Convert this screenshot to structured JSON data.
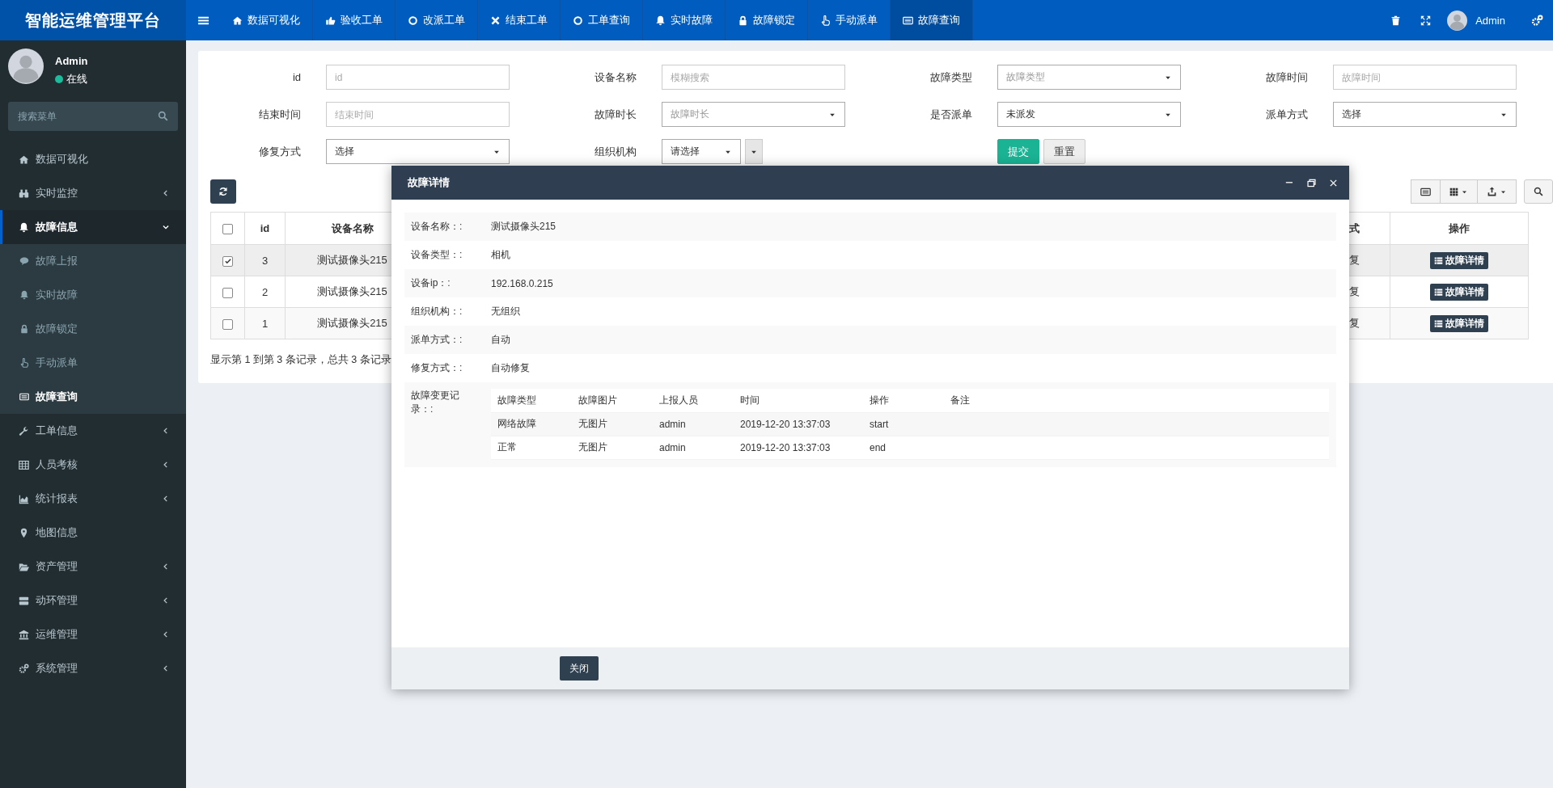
{
  "app": {
    "title": "智能运维管理平台"
  },
  "topnav": {
    "items": [
      {
        "label": "数据可视化",
        "selected": false
      },
      {
        "label": "验收工单",
        "selected": false
      },
      {
        "label": "改派工单",
        "selected": false
      },
      {
        "label": "结束工单",
        "selected": false
      },
      {
        "label": "工单查询",
        "selected": false
      },
      {
        "label": "实时故障",
        "selected": false
      },
      {
        "label": "故障锁定",
        "selected": false
      },
      {
        "label": "手动派单",
        "selected": false
      },
      {
        "label": "故障查询",
        "selected": true
      }
    ],
    "user": "Admin"
  },
  "sidebar": {
    "user": {
      "name": "Admin",
      "status": "在线"
    },
    "search": {
      "placeholder": "搜索菜单"
    },
    "items": [
      {
        "label": "数据可视化",
        "selected": false
      },
      {
        "label": "实时监控",
        "expanded": false,
        "selected": false
      },
      {
        "label": "故障信息",
        "expanded": true,
        "selected": true,
        "children": [
          {
            "label": "故障上报",
            "selected": false
          },
          {
            "label": "实时故障",
            "selected": false
          },
          {
            "label": "故障锁定",
            "selected": false
          },
          {
            "label": "手动派单",
            "selected": false
          },
          {
            "label": "故障查询",
            "selected": true
          }
        ]
      },
      {
        "label": "工单信息",
        "expanded": false,
        "selected": false
      },
      {
        "label": "人员考核",
        "expanded": false,
        "selected": false
      },
      {
        "label": "统计报表",
        "expanded": false,
        "selected": false
      },
      {
        "label": "地图信息",
        "selected": false
      },
      {
        "label": "资产管理",
        "expanded": false,
        "selected": false
      },
      {
        "label": "动环管理",
        "expanded": false,
        "selected": false
      },
      {
        "label": "运维管理",
        "expanded": false,
        "selected": false
      },
      {
        "label": "系统管理",
        "expanded": false,
        "selected": false
      }
    ]
  },
  "filters": [
    {
      "label": "id",
      "kind": "input",
      "placeholder": "id"
    },
    {
      "label": "设备名称",
      "kind": "input",
      "placeholder": "模糊搜索"
    },
    {
      "label": "故障类型",
      "kind": "select",
      "placeholder": "故障类型"
    },
    {
      "label": "故障时间",
      "kind": "input",
      "placeholder": "故障时间"
    },
    {
      "label": "结束时间",
      "kind": "input",
      "placeholder": "结束时间"
    },
    {
      "label": "故障时长",
      "kind": "select",
      "placeholder": "故障时长"
    },
    {
      "label": "是否派单",
      "kind": "select",
      "value": "未派发"
    },
    {
      "label": "派单方式",
      "kind": "select",
      "value": "选择"
    },
    {
      "label": "修复方式",
      "kind": "select",
      "value": "选择"
    },
    {
      "label": "组织机构",
      "kind": "split-select",
      "value": "请选择"
    }
  ],
  "filter_buttons": [
    {
      "label": "提交",
      "kind": "primary"
    },
    {
      "label": "重置",
      "kind": "default"
    }
  ],
  "table": {
    "header_checked": false,
    "columns": [
      "id",
      "设备名称",
      "式",
      "操作"
    ],
    "rows": [
      {
        "checked": true,
        "id": "3",
        "device": "测试摄像头215",
        "column_3": "复",
        "action": "故障详情"
      },
      {
        "checked": false,
        "id": "2",
        "device": "测试摄像头215",
        "column_3": "复",
        "action": "故障详情"
      },
      {
        "checked": false,
        "id": "1",
        "device": "测试摄像头215",
        "column_3": "复",
        "action": "故障详情"
      }
    ],
    "footer": "显示第 1 到第 3 条记录，总共 3 条记录"
  },
  "modal": {
    "title": "故障详情",
    "fields": [
      {
        "label": "设备名称：:",
        "value": "测试摄像头215"
      },
      {
        "label": "设备类型：:",
        "value": "相机"
      },
      {
        "label": "设备ip：:",
        "value": "192.168.0.215"
      },
      {
        "label": "组织机构：:",
        "value": "无组织"
      },
      {
        "label": "派单方式：:",
        "value": "自动"
      },
      {
        "label": "修复方式：:",
        "value": "自动修复"
      }
    ],
    "history": {
      "label": "故障变更记录：:",
      "columns": [
        "故障类型",
        "故障图片",
        "上报人员",
        "时间",
        "操作",
        "备注"
      ],
      "rows": [
        [
          "网络故障",
          "无图片",
          "admin",
          "2019-12-20 13:37:03",
          "start"
        ],
        [
          "正常",
          "无图片",
          "admin",
          "2019-12-20 13:37:03",
          "end"
        ]
      ]
    },
    "close_button": "关闭"
  }
}
